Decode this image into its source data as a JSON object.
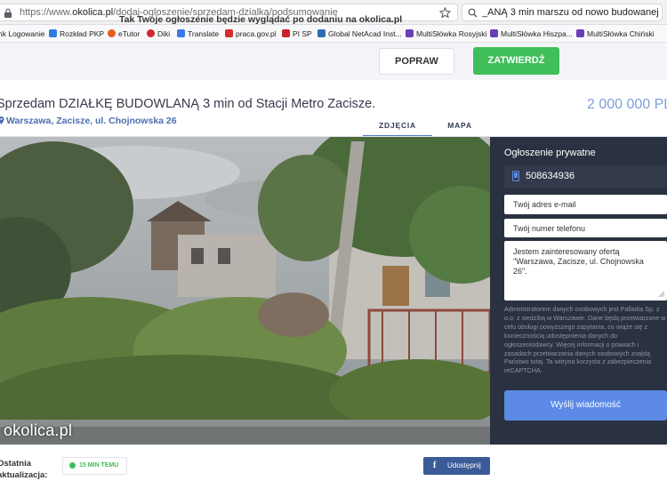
{
  "browser": {
    "url_prefix": "https://www.",
    "url_host": "okolica.pl",
    "url_path": "/dodaj-ogloszenie/sprzedam-dzialka/podsumowanie",
    "search_text": "_ANĄ 3 min marszu od nowo budowanej",
    "bookmarks": [
      {
        "label": "nk Logowanie",
        "color": "#1d5fb5"
      },
      {
        "label": "Rozkład PKP",
        "color": "#2f7be0"
      },
      {
        "label": "eTutor",
        "color": "#e85d1f"
      },
      {
        "label": "Diki",
        "color": "#d3252a"
      },
      {
        "label": "Translate",
        "color": "#3b79e8"
      },
      {
        "label": "praca.gov.pl",
        "color": "#d32d2d"
      },
      {
        "label": "PI SP",
        "color": "#c8232c"
      },
      {
        "label": "Global NetAcad Inst...",
        "color": "#2a6db0"
      },
      {
        "label": "MultiSłówka Rosyjski",
        "color": "#6b3fb3"
      },
      {
        "label": "MultiSłówka Hiszpa...",
        "color": "#6b3fb3"
      },
      {
        "label": "MultiSłówka Chiński",
        "color": "#6b3fb3"
      }
    ]
  },
  "preview": {
    "message": "Tak Twoje ogłoszenie będzie wyglądać po dodaniu na okolica.pl",
    "edit_label": "POPRAW",
    "confirm_label": "ZATWIERDŹ"
  },
  "listing": {
    "title": "Sprzedam DZIAŁKĘ BUDOWLANĄ 3 min od Stacji Metro Zacisze.",
    "location": "Warszawa, Zacisze, ul. Chojnowska 26",
    "price": "2 000 000 PL",
    "tabs": [
      "ZDJĘCIA",
      "MAPA"
    ],
    "watermark": "okolica.pl"
  },
  "contact": {
    "heading": "Ogłoszenie prywatne",
    "phone": "508634936",
    "email_placeholder": "Twój adres e-mail",
    "phone_placeholder": "Twój numer telefonu",
    "message": "Jestem zainteresowany ofertą \"Warszawa, Zacisze, ul. Chojnowska 26\".",
    "privacy": "Administratorem danych osobowych jest Palladia Sp. z o.o. z siedzibą w Warszawie. Dane będą przetwarzane w celu obsługi powyższego zapytania, co wiąże się z koniecznością udostępnienia danych do ogłoszeniodawcy. Więcej informacji o prawach i zasadach przetwarzania danych osobowych znajdą Państwo tutaj. Ta witryna korzysta z zabezpieczenia reCAPTCHA.",
    "send_label": "Wyślij wiadomość"
  },
  "footer": {
    "updated_label_line1": "Ostatnia",
    "updated_label_line2": "aktualizacja:",
    "updated_badge": "15 MIN TEMU",
    "share_label": "Udostępnij"
  }
}
